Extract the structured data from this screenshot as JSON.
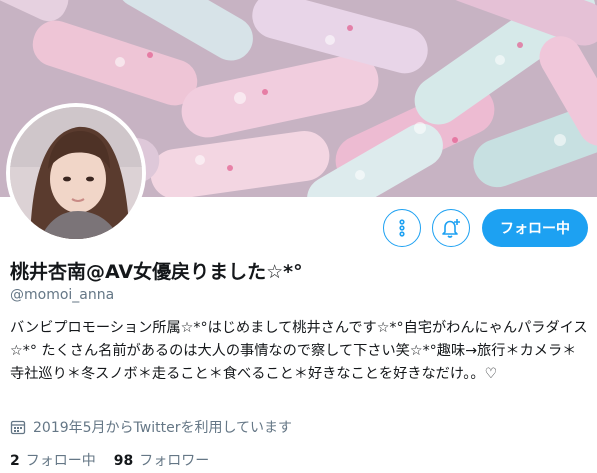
{
  "profile": {
    "display_name": "桃井杏南@AV女優戻りました☆*°",
    "handle": "@momoi_anna",
    "bio": "バンビプロモーション所属☆*°はじめまして桃井さんです☆*°自宅がわんにゃんパラダイス☆*° たくさん名前があるのは大人の事情なので察して下さい笑☆*°趣味→旅行＊カメラ＊寺社巡り＊冬スノボ＊走ること＊食べること＊好きなことを好きなだけ。。♡",
    "joined": "2019年5月からTwitterを利用しています",
    "following_count": "2",
    "following_label": "フォロー中",
    "followers_count": "98",
    "followers_label": "フォロワー"
  },
  "actions": {
    "more_icon": "more-vertical-icon",
    "notify_icon": "bell-plus-icon",
    "follow_label": "フォロー中"
  },
  "colors": {
    "accent": "#1da1f2",
    "text": "#14171a",
    "secondary": "#657786"
  }
}
